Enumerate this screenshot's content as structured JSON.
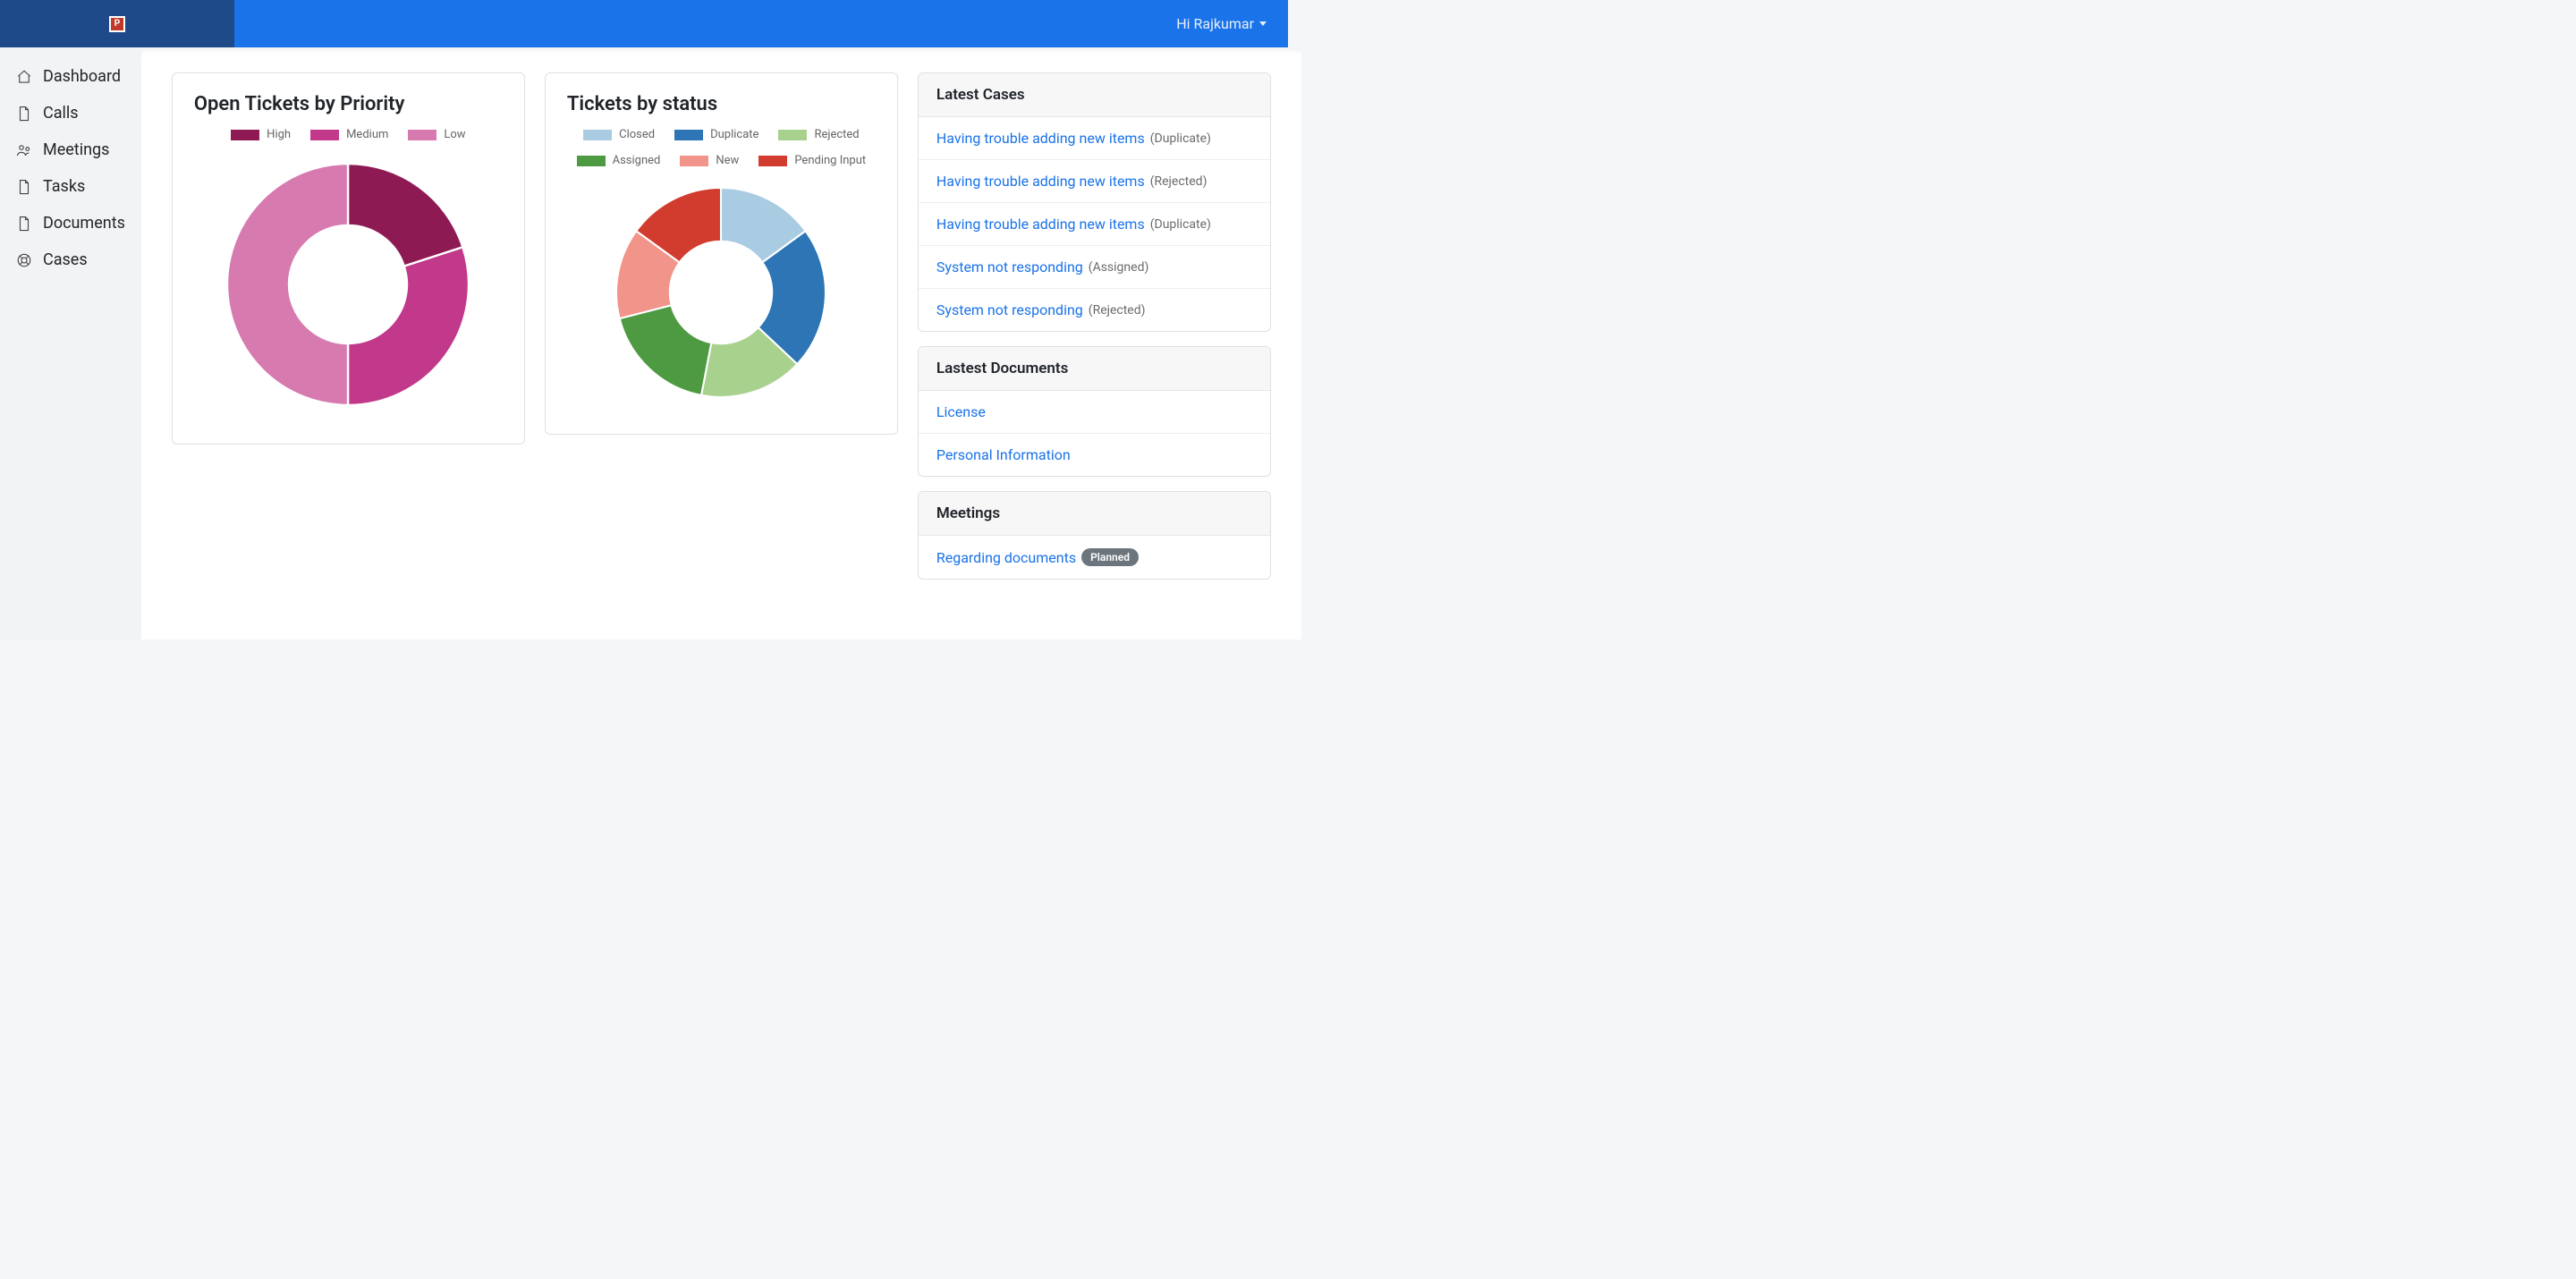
{
  "header": {
    "user_greeting": "Hi Rajkumar"
  },
  "sidebar": {
    "items": [
      {
        "label": "Dashboard",
        "icon": "home-icon"
      },
      {
        "label": "Calls",
        "icon": "file-icon"
      },
      {
        "label": "Meetings",
        "icon": "people-icon"
      },
      {
        "label": "Tasks",
        "icon": "file-icon"
      },
      {
        "label": "Documents",
        "icon": "file-icon"
      },
      {
        "label": "Cases",
        "icon": "lifebuoy-icon"
      }
    ]
  },
  "charts": {
    "priority": {
      "title": "Open Tickets by Priority",
      "legend": [
        "High",
        "Medium",
        "Low"
      ]
    },
    "status": {
      "title": "Tickets by status",
      "legend": [
        "Closed",
        "Duplicate",
        "Rejected",
        "Assigned",
        "New",
        "Pending Input"
      ]
    }
  },
  "panels": {
    "cases": {
      "title": "Latest Cases",
      "items": [
        {
          "title": "Having trouble adding new items",
          "status": "Duplicate"
        },
        {
          "title": "Having trouble adding new items",
          "status": "Rejected"
        },
        {
          "title": "Having trouble adding new items",
          "status": "Duplicate"
        },
        {
          "title": "System not responding",
          "status": "Assigned"
        },
        {
          "title": "System not responding",
          "status": "Rejected"
        }
      ]
    },
    "documents": {
      "title": "Lastest Documents",
      "items": [
        {
          "title": "License"
        },
        {
          "title": "Personal Information"
        }
      ]
    },
    "meetings": {
      "title": "Meetings",
      "items": [
        {
          "title": "Regarding documents",
          "badge": "Planned"
        }
      ]
    }
  },
  "chart_data": [
    {
      "type": "pie",
      "title": "Open Tickets by Priority",
      "series": [
        {
          "name": "High",
          "value": 20,
          "color": "#8e1a54"
        },
        {
          "name": "Medium",
          "value": 30,
          "color": "#c2388a"
        },
        {
          "name": "Low",
          "value": 50,
          "color": "#d67ab0"
        }
      ]
    },
    {
      "type": "pie",
      "title": "Tickets by status",
      "series": [
        {
          "name": "Closed",
          "value": 15,
          "color": "#a9cce3"
        },
        {
          "name": "Duplicate",
          "value": 22,
          "color": "#2e75b6"
        },
        {
          "name": "Rejected",
          "value": 16,
          "color": "#a9d18e"
        },
        {
          "name": "Assigned",
          "value": 18,
          "color": "#4e9a42"
        },
        {
          "name": "New",
          "value": 14,
          "color": "#f1948a"
        },
        {
          "name": "Pending Input",
          "value": 15,
          "color": "#d13c2f"
        }
      ]
    }
  ]
}
